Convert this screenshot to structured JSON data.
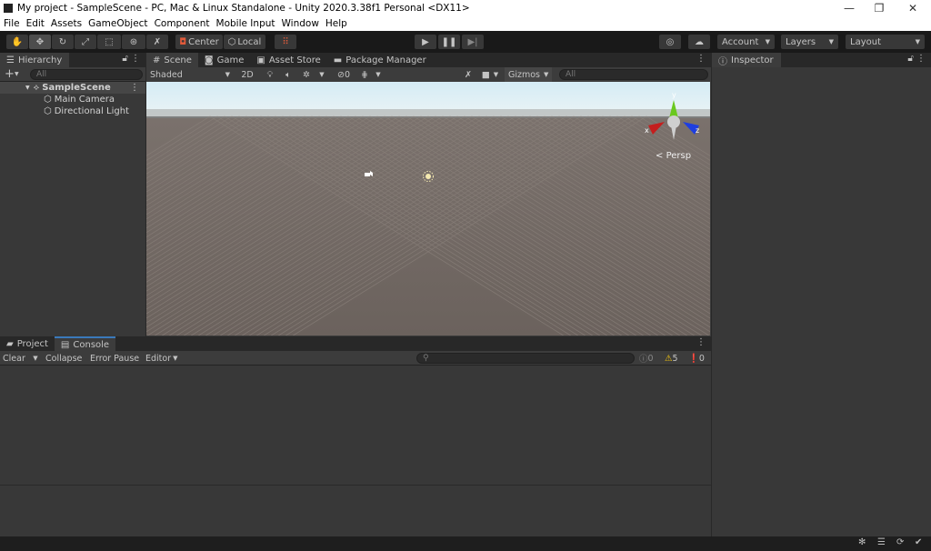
{
  "window": {
    "title": "My project - SampleScene - PC, Mac & Linux Standalone - Unity 2020.3.38f1 Personal <DX11>",
    "minimize": "—",
    "maximize": "❐",
    "close": "✕"
  },
  "menu": [
    "File",
    "Edit",
    "Assets",
    "GameObject",
    "Component",
    "Mobile Input",
    "Window",
    "Help"
  ],
  "toolbar": {
    "tools": [
      "hand",
      "move",
      "rotate",
      "scale",
      "rect",
      "transform",
      "custom"
    ],
    "active_tool": "move",
    "pivot": "Center",
    "space": "Local",
    "account": "Account",
    "layers": "Layers",
    "layout": "Layout"
  },
  "hierarchy": {
    "tab": "Hierarchy",
    "add": "+",
    "search_placeholder": "All",
    "scene": "SampleScene",
    "items": [
      "Main Camera",
      "Directional Light"
    ]
  },
  "scene": {
    "tabs": [
      "Scene",
      "Game",
      "Asset Store",
      "Package Manager"
    ],
    "active_tab": "Scene",
    "shading": "Shaded",
    "mode_2d": "2D",
    "hidden_count": "0",
    "gizmos": "Gizmos",
    "search_placeholder": "All",
    "projection": "Persp",
    "axes": {
      "x": "x",
      "y": "y",
      "z": "z"
    },
    "colors": {
      "x": "#c41e1e",
      "y": "#6ac81e",
      "z": "#1e3ee0"
    }
  },
  "inspector": {
    "tab": "Inspector"
  },
  "bottom": {
    "tabs": [
      "Project",
      "Console"
    ],
    "active_tab": "Console",
    "clear": "Clear",
    "collapse": "Collapse",
    "error_pause": "Error Pause",
    "editor": "Editor",
    "info_count": "0",
    "warning_count": "5",
    "error_count": "0",
    "warning_color": "#f2c40f"
  }
}
